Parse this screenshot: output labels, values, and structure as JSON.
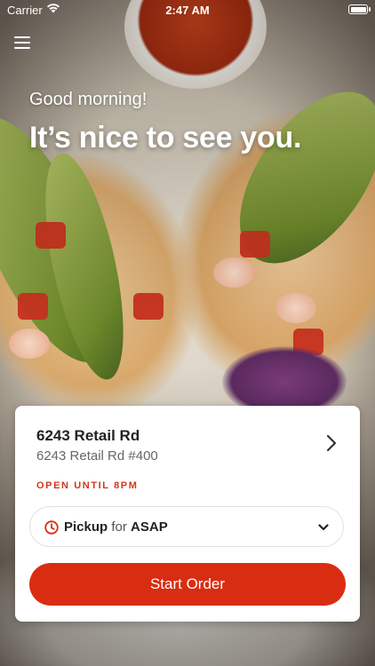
{
  "status_bar": {
    "carrier": "Carrier",
    "time": "2:47 AM"
  },
  "header": {
    "greeting": "Good morning!",
    "headline": "It’s nice to see you."
  },
  "location": {
    "name": "6243 Retail Rd",
    "address": "6243 Retail Rd #400",
    "hours": "OPEN UNTIL 8PM"
  },
  "order_mode": {
    "mode": "Pickup",
    "connector": "for",
    "time": "ASAP"
  },
  "actions": {
    "start_order": "Start Order"
  },
  "colors": {
    "accent": "#d92d12",
    "hours_text": "#d3361c"
  },
  "icons": {
    "menu": "hamburger-menu-icon",
    "wifi": "wifi-icon",
    "battery": "battery-icon",
    "location_chevron": "chevron-right-icon",
    "clock": "clock-icon",
    "dropdown": "chevron-down-icon"
  }
}
